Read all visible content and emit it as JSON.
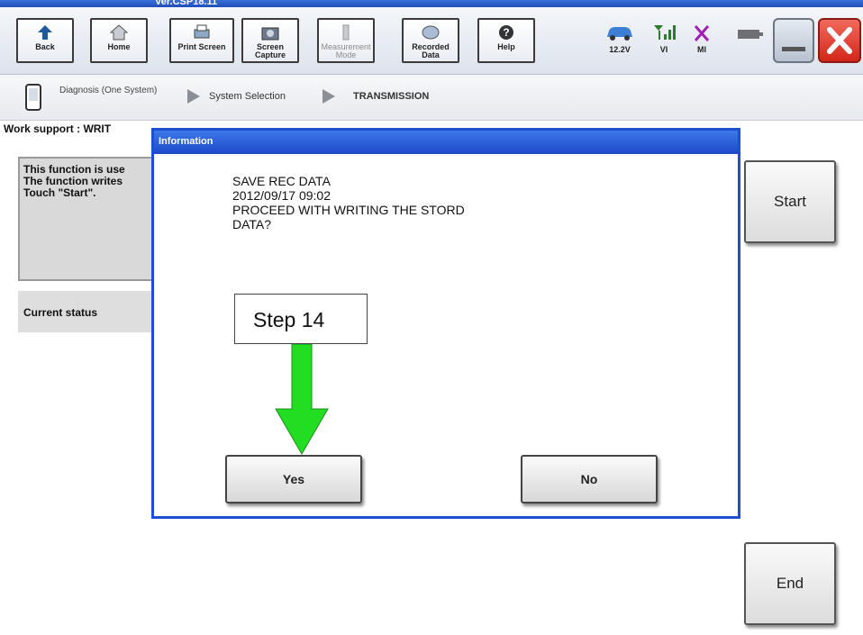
{
  "app": {
    "version": "Ver.CSP18.11"
  },
  "toolbar": {
    "buttons": [
      {
        "label": "Back",
        "icon": "back-arrow-icon"
      },
      {
        "label": "Home",
        "icon": "home-icon"
      },
      {
        "label": "Print Screen",
        "icon": "printer-icon"
      },
      {
        "label": "Screen Capture",
        "icon": "camera-icon"
      },
      {
        "label": "Measurement Mode",
        "icon": "measurement-icon"
      },
      {
        "label": "Recorded Data",
        "icon": "recorded-data-icon"
      },
      {
        "label": "Help",
        "icon": "help-icon"
      }
    ],
    "status": {
      "voltage": "12.2V",
      "vi": "VI",
      "mi": "MI"
    }
  },
  "breadcrumb": {
    "items": [
      "Diagnosis (One System)",
      "System Selection",
      "TRANSMISSION"
    ]
  },
  "work": {
    "title": "Work support : WRIT",
    "description": "This function is use\nThe function writes\nTouch \"Start\".",
    "current_status_label": "Current status",
    "start_label": "Start",
    "end_label": "End"
  },
  "dialog": {
    "title": "Information",
    "lines": [
      "SAVE REC DATA",
      "2012/09/17 09:02",
      "PROCEED WITH WRITING THE STORD",
      "DATA?"
    ],
    "yes_label": "Yes",
    "no_label": "No"
  },
  "annotation": {
    "step_label": "Step 14",
    "arrow_color": "#22dd22"
  },
  "colors": {
    "dialog_border": "#1d4fd2",
    "close_red": "#e23b2e"
  }
}
